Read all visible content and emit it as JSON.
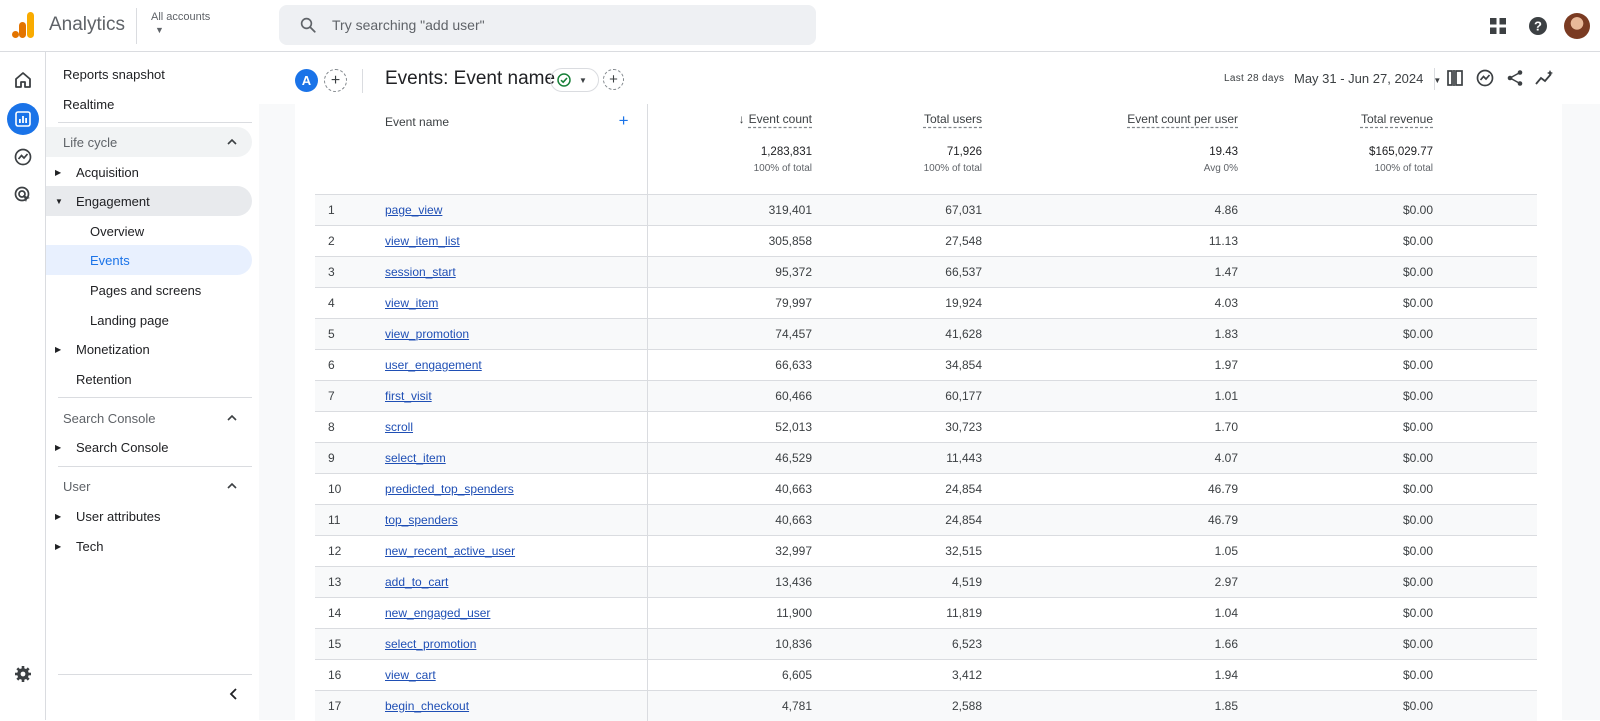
{
  "topbar": {
    "app_title": "Analytics",
    "account_label": "All accounts",
    "search_placeholder": "Try searching \"add user\"",
    "icons": [
      "apps-grid-icon",
      "help-icon",
      "avatar"
    ]
  },
  "rail": {
    "items": [
      "home-icon",
      "reports-icon",
      "explore-icon",
      "advertising-icon",
      "settings-icon"
    ],
    "active": "reports-icon"
  },
  "sidebar": {
    "reports_snapshot": "Reports snapshot",
    "realtime": "Realtime",
    "lifecycle_section": "Life cycle",
    "acquisition": "Acquisition",
    "engagement": "Engagement",
    "overview": "Overview",
    "events": "Events",
    "pages_and_screens": "Pages and screens",
    "landing_page": "Landing page",
    "monetization": "Monetization",
    "retention": "Retention",
    "search_console_section": "Search Console",
    "search_console": "Search Console",
    "user_section": "User",
    "user_attributes": "User attributes",
    "tech": "Tech"
  },
  "header": {
    "comparison_badge": "A",
    "title": "Events: Event name",
    "date_label": "Last 28 days",
    "date_range": "May 31 - Jun 27, 2024"
  },
  "table": {
    "columns": {
      "event_name": "Event name",
      "event_count": "Event count",
      "total_users": "Total users",
      "event_count_per_user": "Event count per user",
      "total_revenue": "Total revenue"
    },
    "totals": {
      "event_count": "1,283,831",
      "event_count_sub": "100% of total",
      "total_users": "71,926",
      "total_users_sub": "100% of total",
      "event_count_per_user": "19.43",
      "event_count_per_user_sub": "Avg 0%",
      "total_revenue": "$165,029.77",
      "total_revenue_sub": "100% of total"
    },
    "rows": [
      {
        "rank": "1",
        "name": "page_view",
        "event_count": "319,401",
        "total_users": "67,031",
        "per_user": "4.86",
        "revenue": "$0.00"
      },
      {
        "rank": "2",
        "name": "view_item_list",
        "event_count": "305,858",
        "total_users": "27,548",
        "per_user": "11.13",
        "revenue": "$0.00"
      },
      {
        "rank": "3",
        "name": "session_start",
        "event_count": "95,372",
        "total_users": "66,537",
        "per_user": "1.47",
        "revenue": "$0.00"
      },
      {
        "rank": "4",
        "name": "view_item",
        "event_count": "79,997",
        "total_users": "19,924",
        "per_user": "4.03",
        "revenue": "$0.00"
      },
      {
        "rank": "5",
        "name": "view_promotion",
        "event_count": "74,457",
        "total_users": "41,628",
        "per_user": "1.83",
        "revenue": "$0.00"
      },
      {
        "rank": "6",
        "name": "user_engagement",
        "event_count": "66,633",
        "total_users": "34,854",
        "per_user": "1.97",
        "revenue": "$0.00"
      },
      {
        "rank": "7",
        "name": "first_visit",
        "event_count": "60,466",
        "total_users": "60,177",
        "per_user": "1.01",
        "revenue": "$0.00"
      },
      {
        "rank": "8",
        "name": "scroll",
        "event_count": "52,013",
        "total_users": "30,723",
        "per_user": "1.70",
        "revenue": "$0.00"
      },
      {
        "rank": "9",
        "name": "select_item",
        "event_count": "46,529",
        "total_users": "11,443",
        "per_user": "4.07",
        "revenue": "$0.00"
      },
      {
        "rank": "10",
        "name": "predicted_top_spenders",
        "event_count": "40,663",
        "total_users": "24,854",
        "per_user": "46.79",
        "revenue": "$0.00"
      },
      {
        "rank": "11",
        "name": "top_spenders",
        "event_count": "40,663",
        "total_users": "24,854",
        "per_user": "46.79",
        "revenue": "$0.00"
      },
      {
        "rank": "12",
        "name": "new_recent_active_user",
        "event_count": "32,997",
        "total_users": "32,515",
        "per_user": "1.05",
        "revenue": "$0.00"
      },
      {
        "rank": "13",
        "name": "add_to_cart",
        "event_count": "13,436",
        "total_users": "4,519",
        "per_user": "2.97",
        "revenue": "$0.00"
      },
      {
        "rank": "14",
        "name": "new_engaged_user",
        "event_count": "11,900",
        "total_users": "11,819",
        "per_user": "1.04",
        "revenue": "$0.00"
      },
      {
        "rank": "15",
        "name": "select_promotion",
        "event_count": "10,836",
        "total_users": "6,523",
        "per_user": "1.66",
        "revenue": "$0.00"
      },
      {
        "rank": "16",
        "name": "view_cart",
        "event_count": "6,605",
        "total_users": "3,412",
        "per_user": "1.94",
        "revenue": "$0.00"
      },
      {
        "rank": "17",
        "name": "begin_checkout",
        "event_count": "4,781",
        "total_users": "2,588",
        "per_user": "1.85",
        "revenue": "$0.00"
      }
    ]
  },
  "colors": {
    "accent": "#1a73e8",
    "link": "#1f4fb5",
    "success": "#188038",
    "logo_orange": "#f9ab00",
    "logo_dark_orange": "#e37400"
  }
}
